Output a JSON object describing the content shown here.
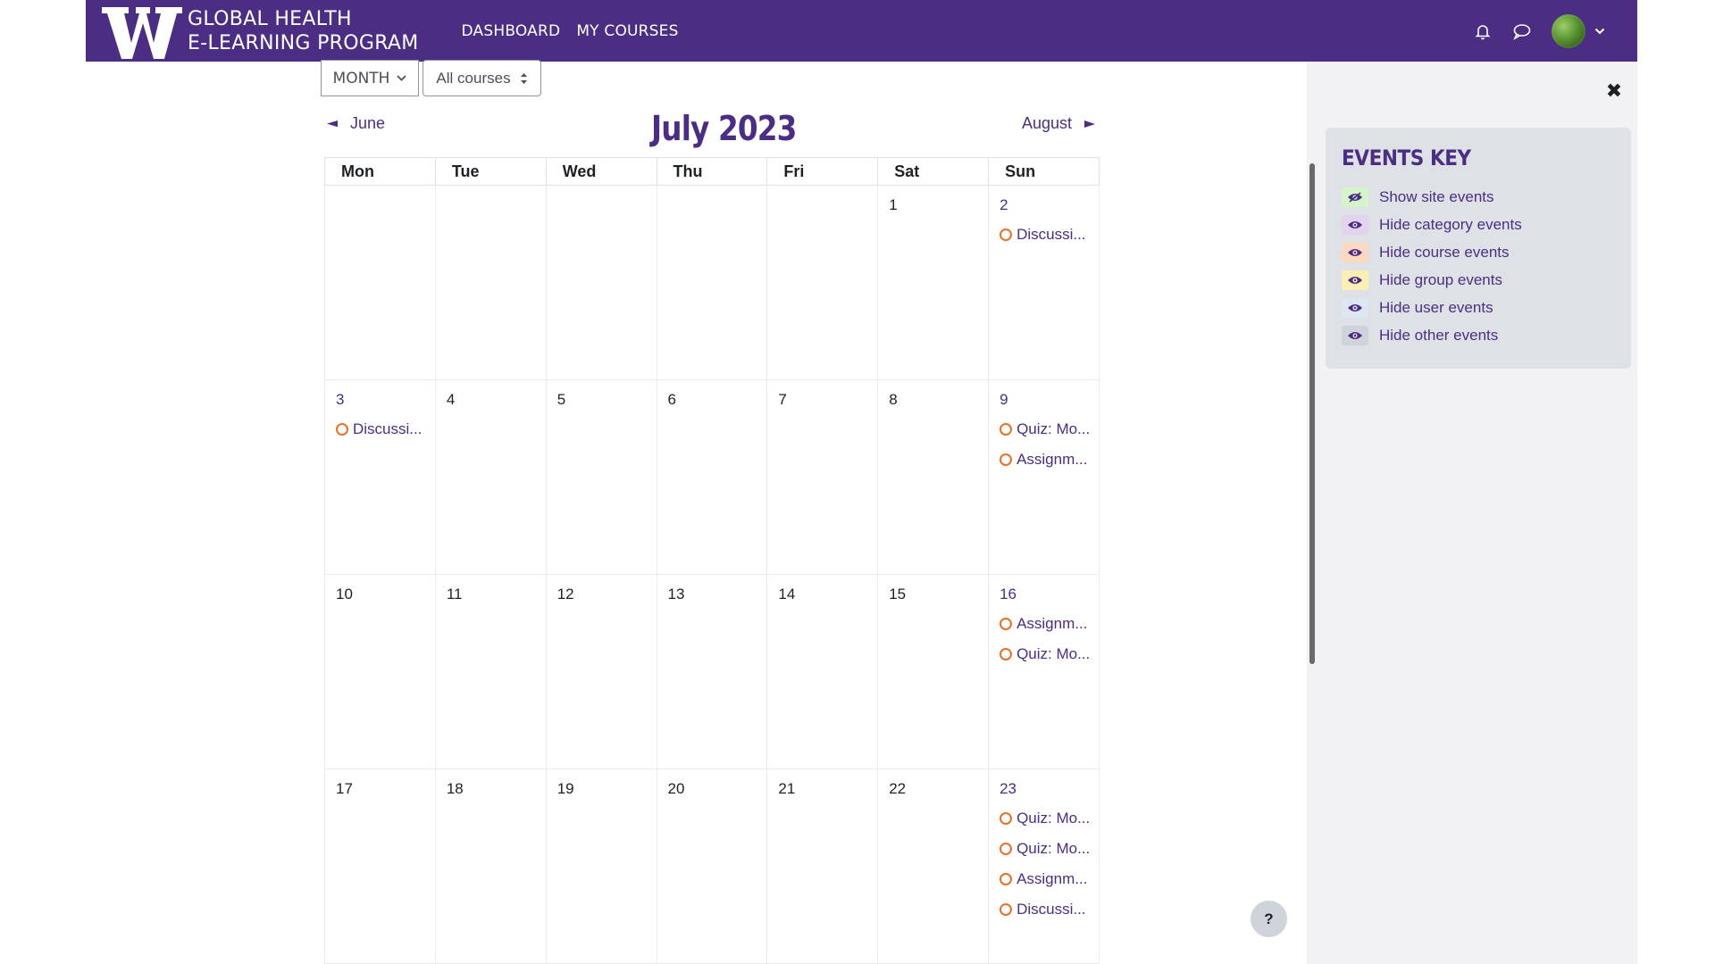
{
  "brand": {
    "line1": "GLOBAL HEALTH",
    "line2": "E-LEARNING PROGRAM"
  },
  "nav": {
    "dashboard": "DASHBOARD",
    "my_courses": "MY COURSES"
  },
  "toolbar": {
    "view": "MONTH",
    "courses": "All courses"
  },
  "calendar": {
    "title": "July 2023",
    "prev": "June",
    "next": "August",
    "weekdays": [
      "Mon",
      "Tue",
      "Wed",
      "Thu",
      "Fri",
      "Sat",
      "Sun"
    ],
    "weeks": [
      [
        {
          "day": "",
          "events": []
        },
        {
          "day": "",
          "events": []
        },
        {
          "day": "",
          "events": []
        },
        {
          "day": "",
          "events": []
        },
        {
          "day": "",
          "events": []
        },
        {
          "day": "1",
          "events": []
        },
        {
          "day": "2",
          "link": true,
          "events": [
            "Discussi..."
          ]
        }
      ],
      [
        {
          "day": "3",
          "link": true,
          "events": [
            "Discussi..."
          ]
        },
        {
          "day": "4",
          "events": []
        },
        {
          "day": "5",
          "events": []
        },
        {
          "day": "6",
          "events": []
        },
        {
          "day": "7",
          "events": []
        },
        {
          "day": "8",
          "events": []
        },
        {
          "day": "9",
          "link": true,
          "events": [
            "Quiz: Mo...",
            "Assignm..."
          ]
        }
      ],
      [
        {
          "day": "10",
          "events": []
        },
        {
          "day": "11",
          "events": []
        },
        {
          "day": "12",
          "events": []
        },
        {
          "day": "13",
          "events": []
        },
        {
          "day": "14",
          "events": []
        },
        {
          "day": "15",
          "events": []
        },
        {
          "day": "16",
          "link": true,
          "events": [
            "Assignm...",
            "Quiz: Mo..."
          ]
        }
      ],
      [
        {
          "day": "17",
          "events": []
        },
        {
          "day": "18",
          "events": []
        },
        {
          "day": "19",
          "events": []
        },
        {
          "day": "20",
          "events": []
        },
        {
          "day": "21",
          "events": []
        },
        {
          "day": "22",
          "events": []
        },
        {
          "day": "23",
          "link": true,
          "events": [
            "Quiz: Mo...",
            "Quiz: Mo...",
            "Assignm...",
            "Discussi..."
          ]
        }
      ]
    ]
  },
  "events_key": {
    "title": "EVENTS KEY",
    "items": [
      {
        "label": "Show site events",
        "color": "#d4f5c9",
        "icon": "eye-slash-icon"
      },
      {
        "label": "Hide category events",
        "color": "#e3d4ee",
        "icon": "eye-icon"
      },
      {
        "label": "Hide course events",
        "color": "#fbd9c1",
        "icon": "eye-icon"
      },
      {
        "label": "Hide group events",
        "color": "#fcefb4",
        "icon": "eye-icon"
      },
      {
        "label": "Hide user events",
        "color": "#dce7f2",
        "icon": "eye-icon"
      },
      {
        "label": "Hide other events",
        "color": "#cfd4da",
        "icon": "eye-icon"
      }
    ]
  },
  "help": {
    "label": "?"
  },
  "colors": {
    "brand": "#4b2e83",
    "event_dot": "#e8702a"
  }
}
